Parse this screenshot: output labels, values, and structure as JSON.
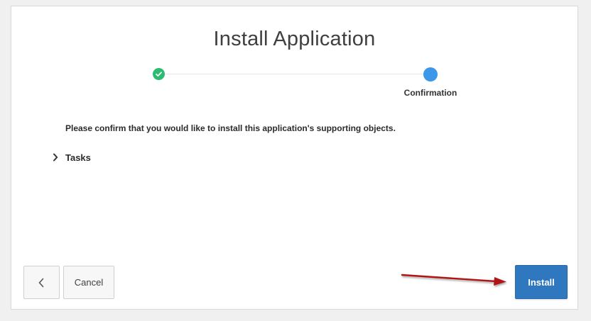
{
  "dialog": {
    "title": "Install Application"
  },
  "wizard": {
    "steps": [
      {
        "label": "",
        "status": "complete"
      },
      {
        "label": "Confirmation",
        "status": "current"
      }
    ]
  },
  "content": {
    "message": "Please confirm that you would like to install this application's supporting objects.",
    "tasks_label": "Tasks"
  },
  "buttons": {
    "cancel_label": "Cancel",
    "install_label": "Install"
  },
  "colors": {
    "complete_step": "#2bbc71",
    "current_step": "#3d97e8",
    "primary_button": "#2f78c0",
    "annotation_arrow": "#b01818"
  },
  "icons": {
    "back": "chevron-left-icon",
    "tasks_toggle": "chevron-right-icon",
    "complete_step": "check-icon"
  }
}
